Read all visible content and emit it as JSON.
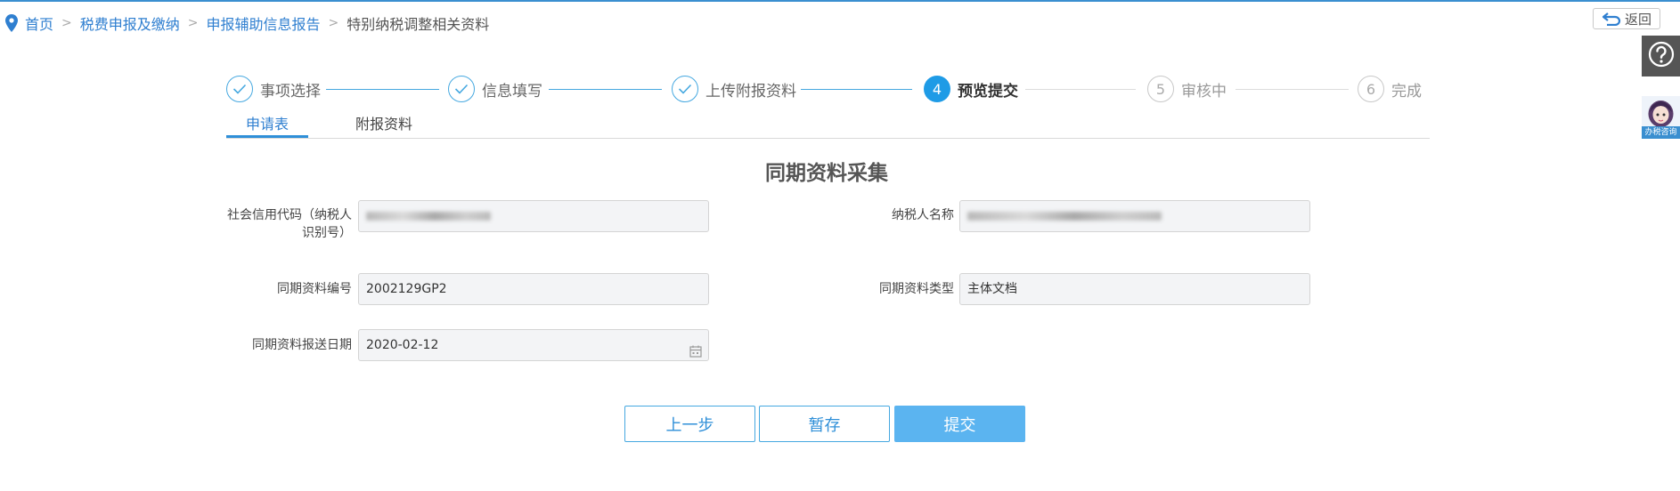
{
  "breadcrumb": {
    "items": [
      "首页",
      "税费申报及缴纳",
      "申报辅助信息报告"
    ],
    "current": "特别纳税调整相关资料",
    "separator": ">"
  },
  "back_label": "返回",
  "assistant_label": "办税咨询",
  "steps": [
    {
      "label": "事项选择",
      "status": "done"
    },
    {
      "label": "信息填写",
      "status": "done"
    },
    {
      "label": "上传附报资料",
      "status": "done"
    },
    {
      "label": "预览提交",
      "status": "active",
      "number": "4"
    },
    {
      "label": "审核中",
      "status": "todo",
      "number": "5"
    },
    {
      "label": "完成",
      "status": "todo",
      "number": "6"
    }
  ],
  "tabs": [
    {
      "label": "申请表",
      "active": true
    },
    {
      "label": "附报资料",
      "active": false
    }
  ],
  "form": {
    "title": "同期资料采集",
    "fields": {
      "credit_code_label": "社会信用代码（纳税人识别号）",
      "credit_code_value": "",
      "taxpayer_name_label": "纳税人名称",
      "taxpayer_name_value": "",
      "doc_number_label": "同期资料编号",
      "doc_number_value": "2002129GP2",
      "doc_type_label": "同期资料类型",
      "doc_type_value": "主体文档",
      "submit_date_label": "同期资料报送日期",
      "submit_date_value": "2020-02-12"
    }
  },
  "buttons": {
    "prev": "上一步",
    "save": "暂存",
    "submit": "提交"
  },
  "colors": {
    "accent": "#2f8fd8",
    "active_step": "#1e9be6",
    "primary_button": "#5bb4f0"
  },
  "icons": {
    "location": "location-pin-icon",
    "back": "return-arrow-icon",
    "help": "question-circle-icon",
    "check": "check-icon",
    "calendar": "calendar-icon"
  }
}
